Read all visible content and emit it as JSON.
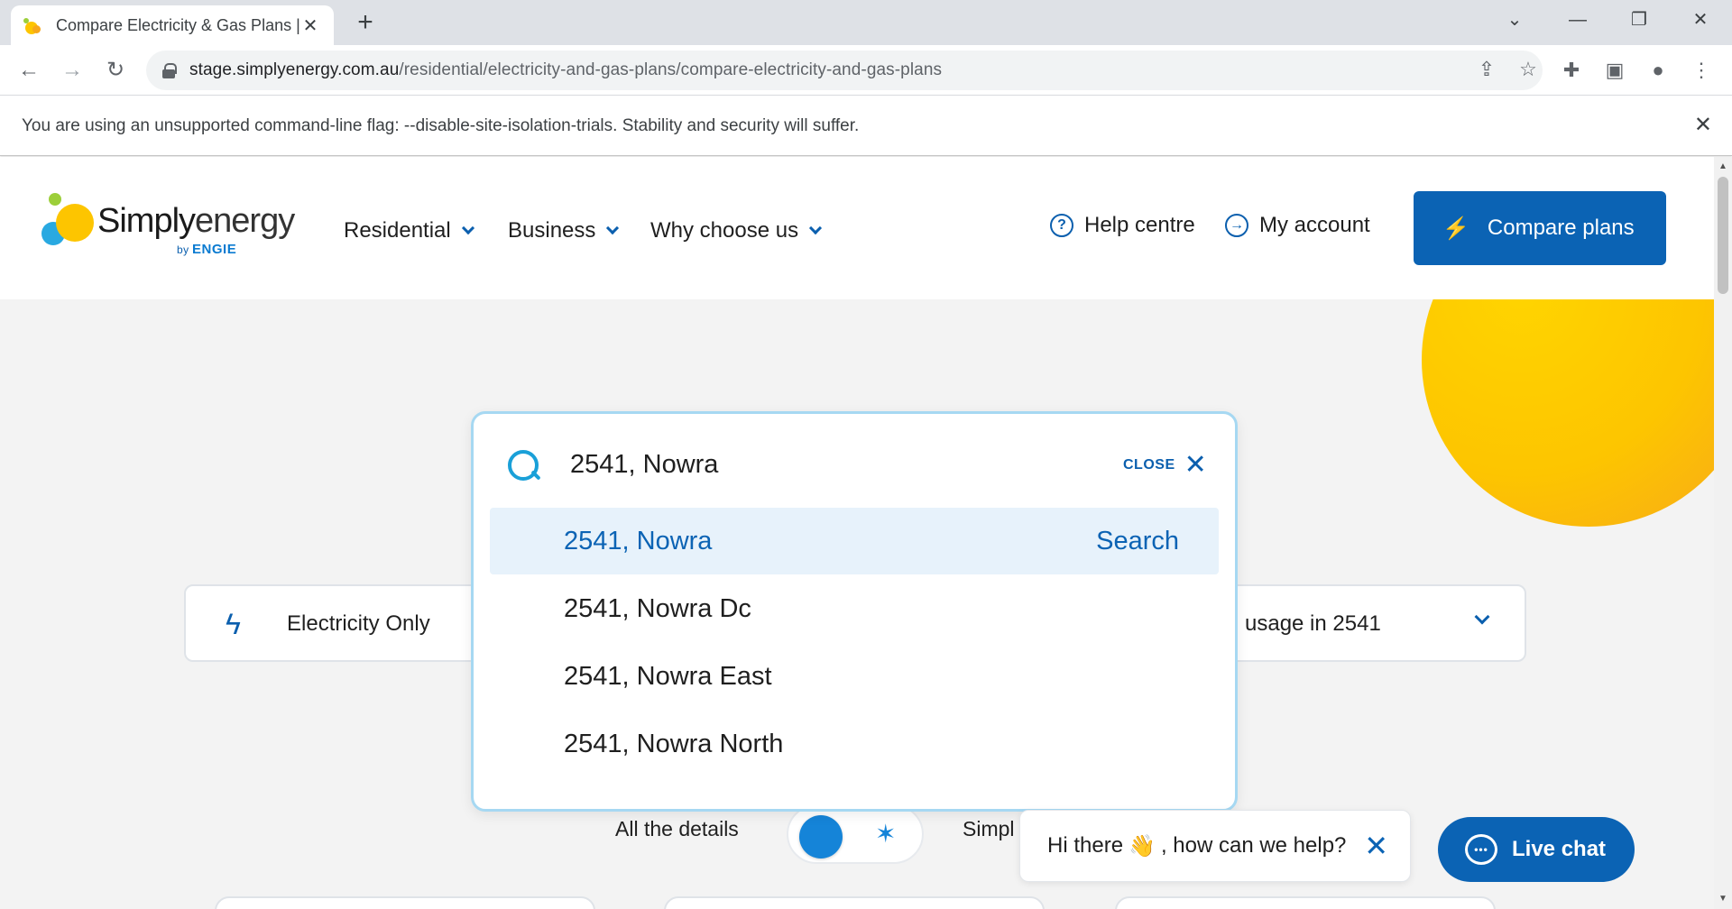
{
  "browser": {
    "tab_title": "Compare Electricity & Gas Plans |",
    "url_host": "stage.simplyenergy.com.au",
    "url_path": "/residential/electricity-and-gas-plans/compare-electricity-and-gas-plans",
    "infobar_text": "You are using an unsupported command-line flag: --disable-site-isolation-trials. Stability and security will suffer."
  },
  "header": {
    "logo_word_a": "Simply",
    "logo_word_b": "energy",
    "logo_by": "by",
    "logo_brand": "ENGIE",
    "nav": [
      {
        "label": "Residential"
      },
      {
        "label": "Business"
      },
      {
        "label": "Why choose us"
      }
    ],
    "help_label": "Help centre",
    "account_label": "My account",
    "compare_label": "Compare plans"
  },
  "filters": {
    "fuel_label": "Electricity Only",
    "usage_label": "usage in 2541"
  },
  "toggle": {
    "left_label": "All the details",
    "right_label": "Simpl"
  },
  "search": {
    "value": "2541, Nowra",
    "close_label": "CLOSE",
    "search_label": "Search",
    "results": [
      {
        "label": "2541, Nowra",
        "active": true
      },
      {
        "label": "2541, Nowra Dc"
      },
      {
        "label": "2541, Nowra East"
      },
      {
        "label": "2541, Nowra North"
      }
    ]
  },
  "chat": {
    "greeting_a": "Hi there",
    "greeting_b": ", how can we help?",
    "wave": "👋",
    "live_chat_label": "Live chat"
  },
  "colors": {
    "brand_blue": "#0b63b4",
    "accent_cyan": "#1aa0d8",
    "sun": "#fdc500"
  }
}
